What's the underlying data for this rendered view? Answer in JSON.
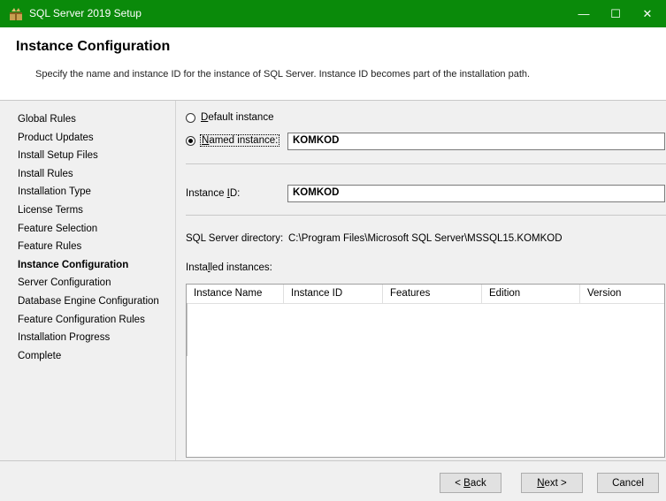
{
  "window": {
    "title": "SQL Server 2019 Setup",
    "accent": "#0a8a0a",
    "controls": {
      "minimize": "—",
      "maximize": "☐",
      "close": "✕"
    }
  },
  "header": {
    "title": "Instance Configuration",
    "description": "Specify the name and instance ID for the instance of SQL Server. Instance ID becomes part of the installation path."
  },
  "nav": {
    "items": [
      {
        "label": "Global Rules"
      },
      {
        "label": "Product Updates"
      },
      {
        "label": "Install Setup Files"
      },
      {
        "label": "Install Rules"
      },
      {
        "label": "Installation Type"
      },
      {
        "label": "License Terms"
      },
      {
        "label": "Feature Selection"
      },
      {
        "label": "Feature Rules"
      },
      {
        "label": "Instance Configuration",
        "active": true
      },
      {
        "label": "Server Configuration"
      },
      {
        "label": "Database Engine Configuration"
      },
      {
        "label": "Feature Configuration Rules"
      },
      {
        "label": "Installation Progress"
      },
      {
        "label": "Complete"
      }
    ]
  },
  "instance": {
    "default_label_accel": "D",
    "default_label_rest": "efault instance",
    "named_label_accel": "N",
    "named_label_rest": "amed instance:",
    "named_value": "KOMKOD",
    "selected": "named",
    "id_label_pre": "Instance ",
    "id_label_accel": "I",
    "id_label_post": "D:",
    "id_value": "KOMKOD",
    "dir_label": "SQL Server directory:",
    "dir_value": "C:\\Program Files\\Microsoft SQL Server\\MSSQL15.KOMKOD",
    "installed_pre": "Insta",
    "installed_accel": "l",
    "installed_post": "led instances:"
  },
  "grid": {
    "columns": [
      "Instance Name",
      "Instance ID",
      "Features",
      "Edition",
      "Version"
    ],
    "rows": []
  },
  "buttons": {
    "back_pre": "< ",
    "back_accel": "B",
    "back_post": "ack",
    "next_accel": "N",
    "next_post": "ext >",
    "cancel": "Cancel"
  }
}
